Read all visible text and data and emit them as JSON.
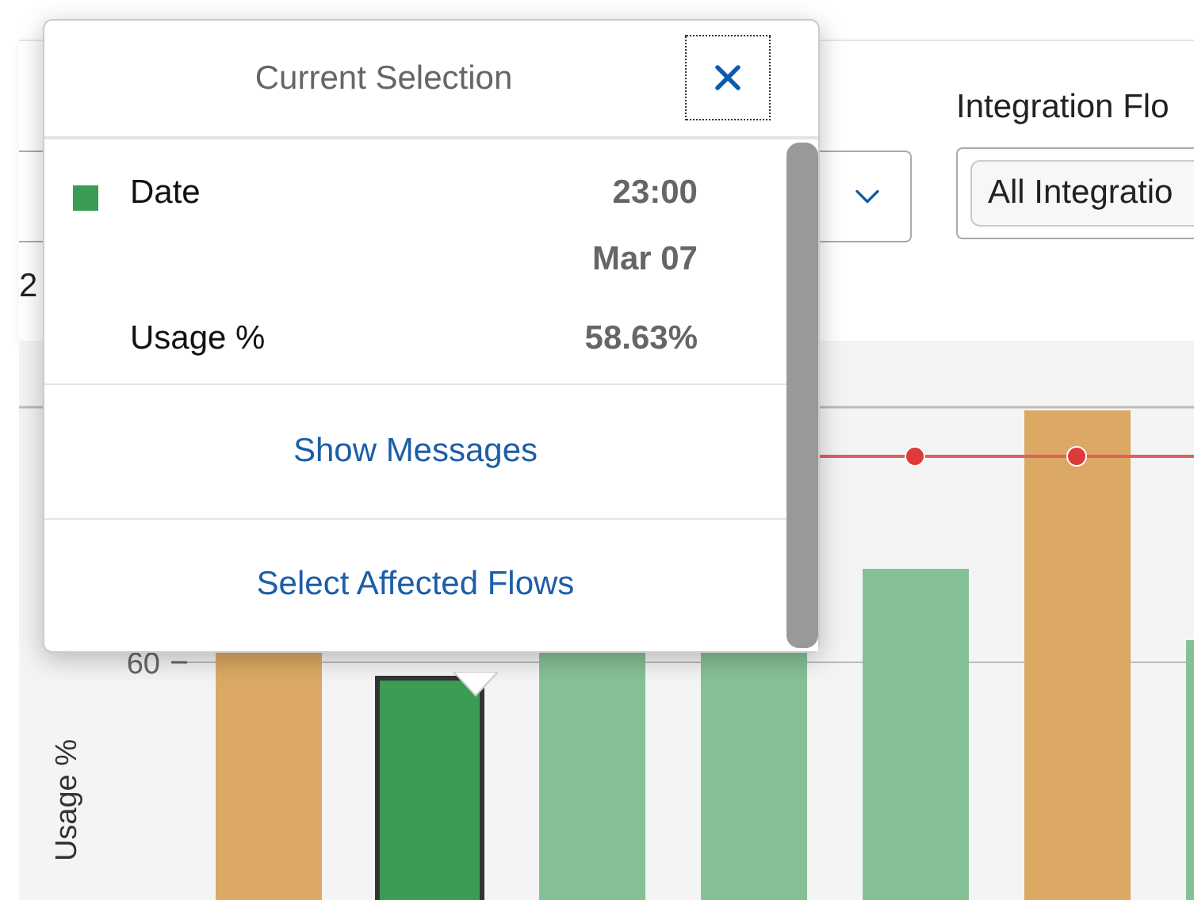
{
  "filters": {
    "date_fragment": "2",
    "integration_flow": {
      "label": "Integration Flo",
      "value": "All Integratio"
    }
  },
  "chart": {
    "y_axis_label": "Usage %",
    "tick_label": "60",
    "bars": [
      {
        "color": "#dba963",
        "selected": false
      },
      {
        "color": "#3a9c55",
        "selected": true
      },
      {
        "color": "#86c096",
        "selected": false
      },
      {
        "color": "#86c096",
        "selected": false
      },
      {
        "color": "#86c096",
        "selected": false
      },
      {
        "color": "#dba963",
        "selected": false
      },
      {
        "color": "#86c096",
        "selected": false
      }
    ]
  },
  "popover": {
    "title": "Current Selection",
    "rows": [
      {
        "label": "Date",
        "values": [
          "23:00",
          "Mar 07"
        ],
        "color": "#3a9c55"
      },
      {
        "label": "Usage %",
        "values": [
          "58.63%"
        ]
      }
    ],
    "actions": [
      "Show Messages",
      "Select Affected Flows"
    ]
  }
}
